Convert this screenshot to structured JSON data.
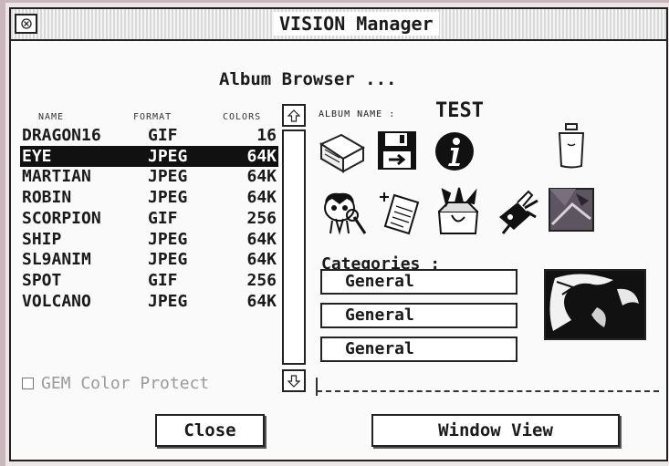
{
  "window": {
    "title": "VISION Manager"
  },
  "browser": {
    "heading": "Album Browser ..."
  },
  "columns": {
    "name": "NAME",
    "format": "FORMAT",
    "colors": "COLORS"
  },
  "files": [
    {
      "name": "DRAGON16",
      "format": "GIF",
      "colors": "16",
      "selected": false
    },
    {
      "name": "EYE",
      "format": "JPEG",
      "colors": "64K",
      "selected": true
    },
    {
      "name": "MARTIAN",
      "format": "JPEG",
      "colors": "64K",
      "selected": false
    },
    {
      "name": "ROBIN",
      "format": "JPEG",
      "colors": "64K",
      "selected": false
    },
    {
      "name": "SCORPION",
      "format": "GIF",
      "colors": "256",
      "selected": false
    },
    {
      "name": "SHIP",
      "format": "JPEG",
      "colors": "64K",
      "selected": false
    },
    {
      "name": "SL9ANIM",
      "format": "JPEG",
      "colors": "64K",
      "selected": false
    },
    {
      "name": "SPOT",
      "format": "GIF",
      "colors": "256",
      "selected": false
    },
    {
      "name": "VOLCANO",
      "format": "JPEG",
      "colors": "64K",
      "selected": false
    }
  ],
  "protect": {
    "label": "GEM Color Protect",
    "checked": false
  },
  "album": {
    "label": "ALBUM NAME :",
    "value": "TEST"
  },
  "icons": [
    "open-album-icon",
    "save-disk-icon",
    "info-icon",
    "trash-icon",
    "viewer-icon",
    "add-page-icon",
    "tools-box-icon",
    "swiss-knife-icon",
    "image-preview-icon"
  ],
  "categories": {
    "label": "Categories :",
    "items": [
      "General",
      "General",
      "General"
    ]
  },
  "buttons": {
    "close": "Close",
    "window_view": "Window View"
  }
}
